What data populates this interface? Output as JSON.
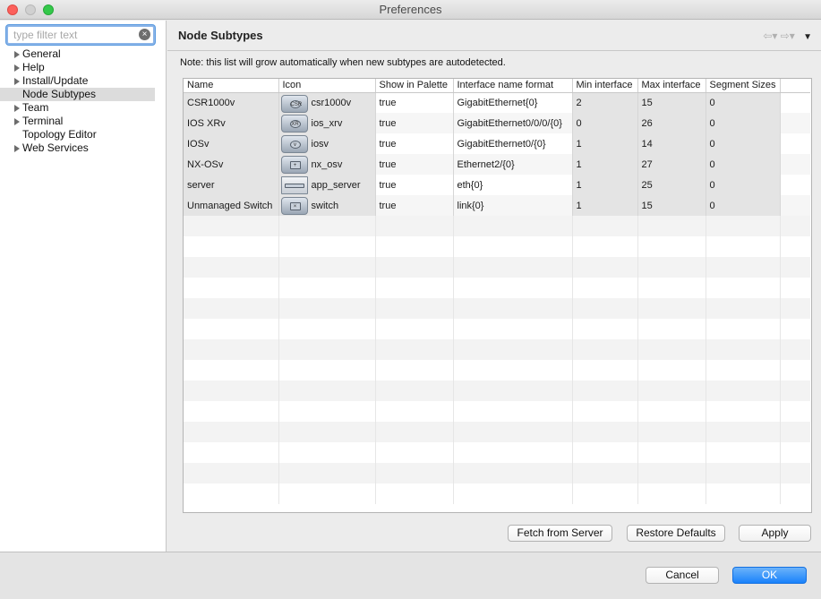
{
  "window": {
    "title": "Preferences"
  },
  "filter": {
    "placeholder": "type filter text"
  },
  "tree": [
    {
      "label": "General",
      "expandable": true,
      "selected": false
    },
    {
      "label": "Help",
      "expandable": true,
      "selected": false
    },
    {
      "label": "Install/Update",
      "expandable": true,
      "selected": false
    },
    {
      "label": "Node Subtypes",
      "expandable": false,
      "selected": true
    },
    {
      "label": "Team",
      "expandable": true,
      "selected": false
    },
    {
      "label": "Terminal",
      "expandable": true,
      "selected": false
    },
    {
      "label": "Topology Editor",
      "expandable": false,
      "selected": false
    },
    {
      "label": "Web Services",
      "expandable": true,
      "selected": false
    }
  ],
  "page": {
    "title": "Node Subtypes",
    "note": "Note: this list will grow automatically when new subtypes are autodetected."
  },
  "table": {
    "columns": [
      "Name",
      "Icon",
      "Show in Palette",
      "Interface name format",
      "Min interface",
      "Max interface",
      "Segment Sizes"
    ],
    "rows": [
      {
        "name": "CSR1000v",
        "icon": "csr1000v",
        "icon_symbol": "router-icon",
        "glyph": "CSR",
        "show": "true",
        "format": "GigabitEthernet{0}",
        "min": "2",
        "max": "15",
        "seg": "0"
      },
      {
        "name": "IOS XRv",
        "icon": "ios_xrv",
        "icon_symbol": "router-icon",
        "glyph": "XR",
        "show": "true",
        "format": "GigabitEthernet0/0/0/{0}",
        "min": "0",
        "max": "26",
        "seg": "0"
      },
      {
        "name": "IOSv",
        "icon": "iosv",
        "icon_symbol": "router-icon",
        "glyph": "v",
        "show": "true",
        "format": "GigabitEthernet0/{0}",
        "min": "1",
        "max": "14",
        "seg": "0"
      },
      {
        "name": "NX-OSv",
        "icon": "nx_osv",
        "icon_symbol": "nexus-switch-icon",
        "glyph": "+",
        "show": "true",
        "format": "Ethernet2/{0}",
        "min": "1",
        "max": "27",
        "seg": "0"
      },
      {
        "name": "server",
        "icon": "app_server",
        "icon_symbol": "server-icon",
        "glyph": "",
        "show": "true",
        "format": "eth{0}",
        "min": "1",
        "max": "25",
        "seg": "0"
      },
      {
        "name": "Unmanaged Switch",
        "icon": "switch",
        "icon_symbol": "switch-icon",
        "glyph": "×",
        "show": "true",
        "format": "link{0}",
        "min": "1",
        "max": "15",
        "seg": "0"
      }
    ]
  },
  "buttons": {
    "fetch": "Fetch from Server",
    "restore": "Restore Defaults",
    "apply": "Apply",
    "cancel": "Cancel",
    "ok": "OK"
  },
  "nav": {
    "back": "⇦",
    "forward": "⇨",
    "menu": "▼"
  },
  "colors": {
    "accent": "#1a82fb",
    "selection": "#dcdcdc"
  }
}
